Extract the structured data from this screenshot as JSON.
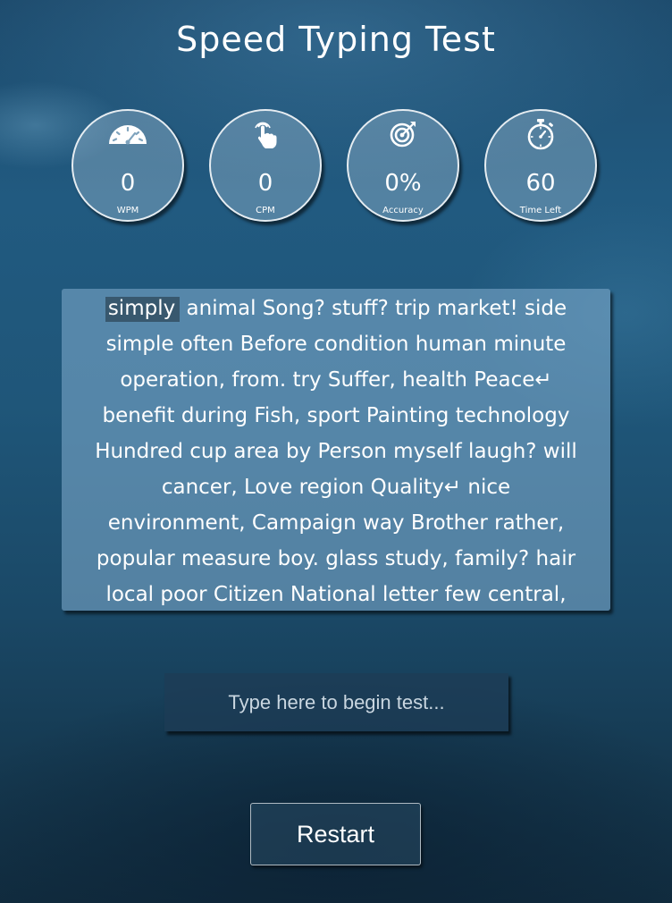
{
  "title": "Speed Typing Test",
  "stats": [
    {
      "icon": "speedometer-icon",
      "value": "0",
      "label": "WPM"
    },
    {
      "icon": "tap-hand-icon",
      "value": "0",
      "label": "CPM"
    },
    {
      "icon": "target-icon",
      "value": "0%",
      "label": "Accuracy"
    },
    {
      "icon": "stopwatch-icon",
      "value": "60",
      "label": "Time Left"
    }
  ],
  "quote": {
    "current_word": "simply",
    "lines": [
      "animal Song? stuff? trip market! side",
      "simple often Before condition human minute",
      "operation, from. try Suffer, health Peace↵",
      "benefit during Fish, sport Painting technology",
      "Hundred cup area by Person myself laugh? will",
      "cancer, Love region Quality↵ nice",
      "environment, Campaign way Brother rather,",
      "popular measure boy. glass study, family? hair",
      "local poor Citizen National letter few central,"
    ]
  },
  "input": {
    "placeholder": "Type here to begin test...",
    "value": ""
  },
  "restart_label": "Restart",
  "colors": {
    "text": "#ffffff",
    "panel": "#78a5c6",
    "background": "#1f5679"
  }
}
